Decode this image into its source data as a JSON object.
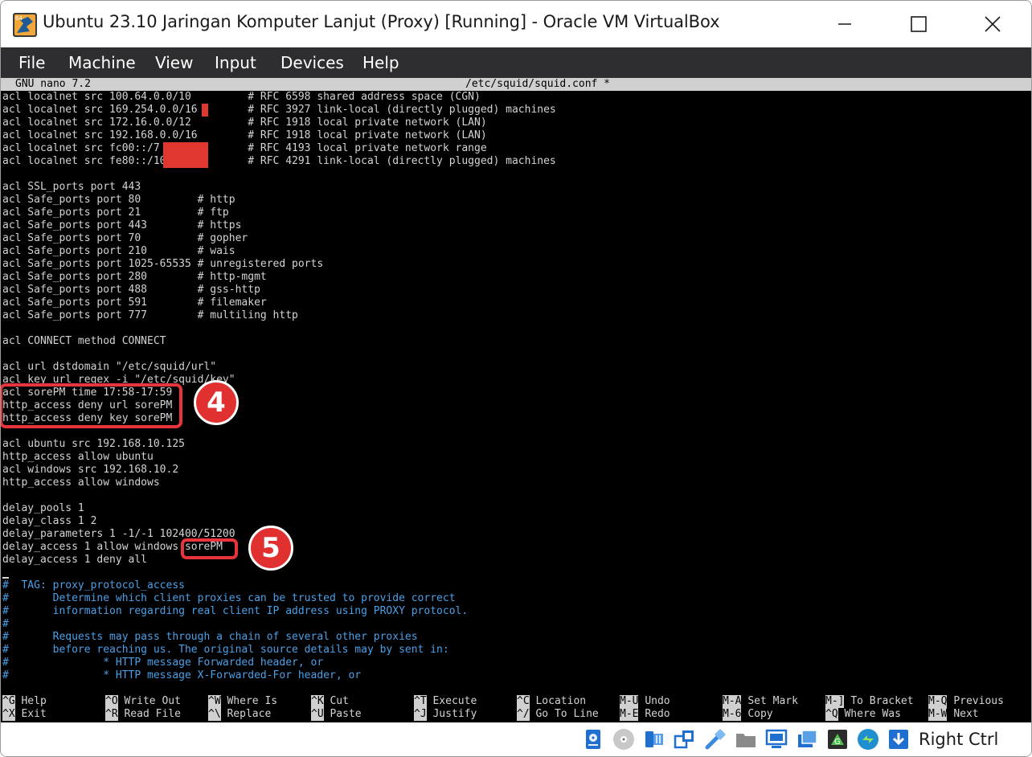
{
  "window": {
    "title": "Ubuntu 23.10 Jaringan Komputer Lanjut (Proxy) [Running] - Oracle VM VirtualBox",
    "icon": "virtualbox-64-icon"
  },
  "menu": [
    "File",
    "Machine",
    "View",
    "Input",
    "Devices",
    "Help"
  ],
  "nano": {
    "version": "GNU nano 7.2",
    "filename": "/etc/squid/squid.conf *"
  },
  "lines": [
    "acl localnet src 100.64.0.0/10         # RFC 6598 shared address space (CGN)",
    "acl localnet src 169.254.0.0/16        # RFC 3927 link-local (directly plugged) machines",
    "acl localnet src 172.16.0.0/12         # RFC 1918 local private network (LAN)",
    "acl localnet src 192.168.0.0/16        # RFC 1918 local private network (LAN)",
    "acl localnet src fc00::/7              # RFC 4193 local private network range",
    "acl localnet src fe80::/10             # RFC 4291 link-local (directly plugged) machines",
    "",
    "acl SSL_ports port 443",
    "acl Safe_ports port 80         # http",
    "acl Safe_ports port 21         # ftp",
    "acl Safe_ports port 443        # https",
    "acl Safe_ports port 70         # gopher",
    "acl Safe_ports port 210        # wais",
    "acl Safe_ports port 1025-65535 # unregistered ports",
    "acl Safe_ports port 280        # http-mgmt",
    "acl Safe_ports port 488        # gss-http",
    "acl Safe_ports port 591        # filemaker",
    "acl Safe_ports port 777        # multiling http",
    "",
    "acl CONNECT method CONNECT",
    "",
    "acl url dstdomain \"/etc/squid/url\"",
    "acl key url_regex -i \"/etc/squid/key\"",
    "acl sorePM time 17:58-17:59",
    "http_access deny url sorePM",
    "http_access deny key sorePM",
    "",
    "acl ubuntu src 192.168.10.125",
    "http_access allow ubuntu",
    "acl windows src 192.168.10.2",
    "http_access allow windows",
    "",
    "delay_pools 1",
    "delay_class 1 2",
    "delay_parameters 1 -1/-1 102400/51200",
    "delay_access 1 allow windows sorePM",
    "delay_access 1 deny all",
    "",
    "#  TAG: proxy_protocol_access",
    "#       Determine which client proxies can be trusted to provide correct",
    "#       information regarding real client IP address using PROXY protocol.",
    "#",
    "#       Requests may pass through a chain of several other proxies",
    "#       before reaching us. The original source details may by sent in:",
    "#               * HTTP message Forwarded header, or",
    "#               * HTTP message X-Forwarded-For header, or"
  ],
  "annotations": [
    "4",
    "5"
  ],
  "shortcuts": [
    {
      "key": "^G",
      "label": "Help"
    },
    {
      "key": "^X",
      "label": "Exit"
    },
    {
      "key": "^O",
      "label": "Write Out"
    },
    {
      "key": "^R",
      "label": "Read File"
    },
    {
      "key": "^W",
      "label": "Where Is"
    },
    {
      "key": "^\\",
      "label": "Replace"
    },
    {
      "key": "^K",
      "label": "Cut"
    },
    {
      "key": "^U",
      "label": "Paste"
    },
    {
      "key": "^T",
      "label": "Execute"
    },
    {
      "key": "^J",
      "label": "Justify"
    },
    {
      "key": "^C",
      "label": "Location"
    },
    {
      "key": "^/",
      "label": "Go To Line"
    },
    {
      "key": "M-U",
      "label": "Undo"
    },
    {
      "key": "M-E",
      "label": "Redo"
    },
    {
      "key": "M-A",
      "label": "Set Mark"
    },
    {
      "key": "M-6",
      "label": "Copy"
    },
    {
      "key": "M-]",
      "label": "To Bracket"
    },
    {
      "key": "^Q",
      "label": "Where Was"
    },
    {
      "key": "M-Q",
      "label": "Previous"
    },
    {
      "key": "M-W",
      "label": "Next"
    }
  ],
  "statusbar": {
    "icons": [
      "hard-disk-icon",
      "optical-disk-icon",
      "audio-icon",
      "network-icon",
      "usb-icon",
      "shared-folder-icon",
      "display-icon",
      "video-capture-icon",
      "guest-additions-icon",
      "virtualization-icon",
      "download-arrow-icon"
    ],
    "host_key": "Right Ctrl"
  },
  "colors": {
    "terminal_bg": "#000000",
    "terminal_text": "#d4d4d4",
    "comment_text": "#4aa0e8",
    "annotation_red": "#e8343b",
    "menubar_bg": "#2e2e30"
  }
}
